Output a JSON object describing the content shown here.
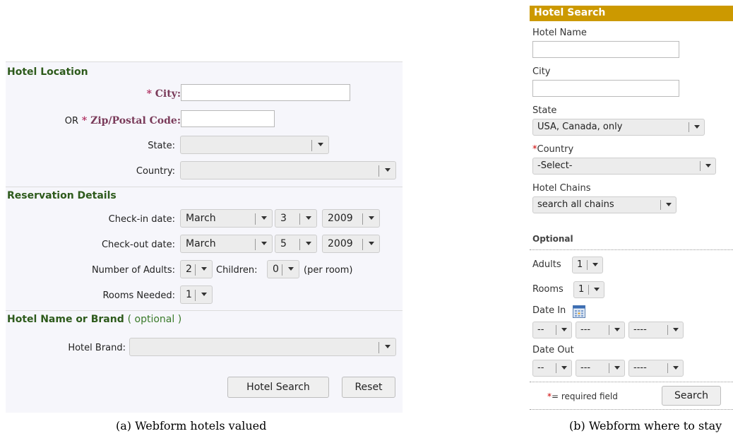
{
  "panel_a": {
    "sections": {
      "location": "Hotel Location",
      "reservation": "Reservation Details",
      "name_brand": "Hotel Name or Brand",
      "name_brand_optional": "( optional )"
    },
    "city_label": "City:",
    "zip_or": "OR",
    "zip_label": "Zip/Postal Code:",
    "required_mark": "*",
    "state_label": "State:",
    "country_label": "Country:",
    "checkin_label": "Check-in date:",
    "checkin": {
      "month": "March",
      "day": "3",
      "year": "2009"
    },
    "checkout_label": "Check-out date:",
    "checkout": {
      "month": "March",
      "day": "5",
      "year": "2009"
    },
    "adults_label": "Number of Adults:",
    "adults_value": "2",
    "children_label": "Children:",
    "children_value": "0",
    "per_room": "(per room)",
    "rooms_label": "Rooms Needed:",
    "rooms_value": "1",
    "brand_label": "Hotel Brand:",
    "search_button": "Hotel Search",
    "reset_button": "Reset"
  },
  "panel_b": {
    "title": "Hotel Search",
    "hotel_name_label": "Hotel Name",
    "city_label": "City",
    "state_label": "State",
    "state_value": "USA, Canada, only",
    "country_mark": "*",
    "country_label": "Country",
    "country_value": "-Select-",
    "chains_label": "Hotel Chains",
    "chains_value": "search all chains",
    "optional_heading": "Optional",
    "adults_label": "Adults",
    "adults_value": "1",
    "rooms_label": "Rooms",
    "rooms_value": "1",
    "date_in_label": "Date In",
    "date_in": {
      "day": "--",
      "month": "---",
      "year": "----"
    },
    "date_out_label": "Date Out",
    "date_out": {
      "day": "--",
      "month": "---",
      "year": "----"
    },
    "required_mark": "*",
    "required_note": "= required field",
    "search_button": "Search"
  },
  "captions": {
    "a": "(a) Webform hotels valued",
    "b": "(b) Webform where to stay"
  },
  "icons": {
    "calendar": "calendar-icon",
    "dropdown": "chevron-down-icon"
  },
  "colors": {
    "header_gold": "#cc9900",
    "section_green": "#2d5a1b",
    "required_red": "#cc0000"
  }
}
